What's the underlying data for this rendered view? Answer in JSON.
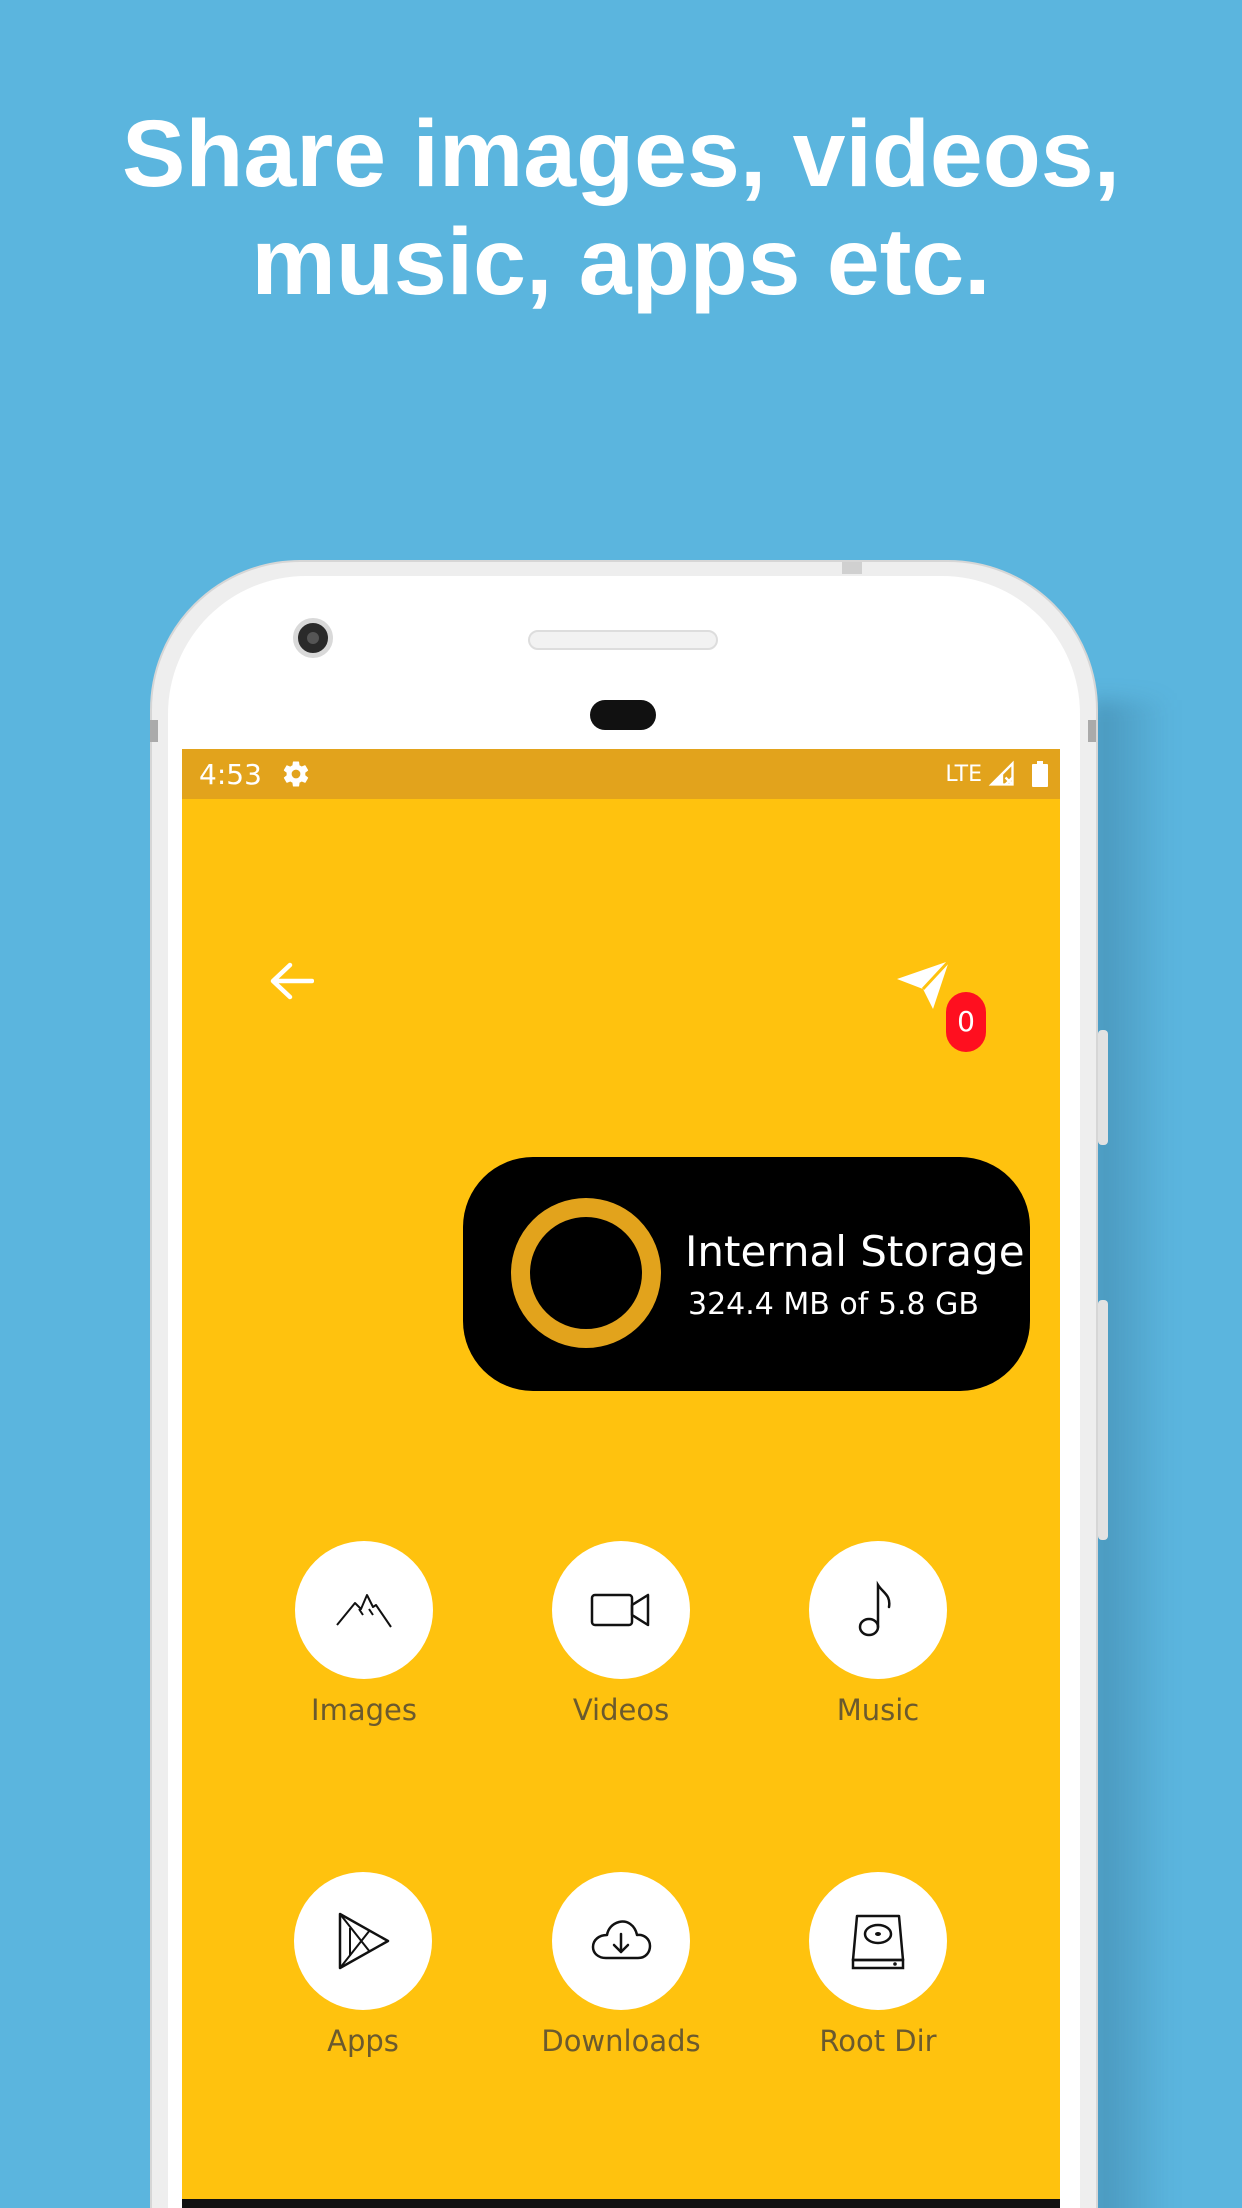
{
  "headline": {
    "line1": "Share images, videos,",
    "line2": "music, apps etc."
  },
  "status_bar": {
    "time": "4:53",
    "network": "LTE",
    "icons": [
      "gear-icon",
      "signal-icon",
      "battery-icon"
    ]
  },
  "toolbar": {
    "back_icon": "arrow-left-icon",
    "send_icon": "paper-plane-icon",
    "send_count": "0"
  },
  "storage": {
    "title": "Internal Storage",
    "usage": "324.4 MB of 5.8 GB"
  },
  "categories": [
    {
      "label": "Images",
      "icon": "mountain-icon"
    },
    {
      "label": "Videos",
      "icon": "video-camera-icon"
    },
    {
      "label": "Music",
      "icon": "music-note-icon"
    },
    {
      "label": "Apps",
      "icon": "play-store-icon"
    },
    {
      "label": "Downloads",
      "icon": "cloud-download-icon"
    },
    {
      "label": "Root Dir",
      "icon": "hard-drive-icon"
    }
  ],
  "colors": {
    "background": "#5BB5DE",
    "screen": "#FFC20E",
    "status_bar": "#E2A31C",
    "badge": "#FF0F1F",
    "card": "#000000"
  }
}
